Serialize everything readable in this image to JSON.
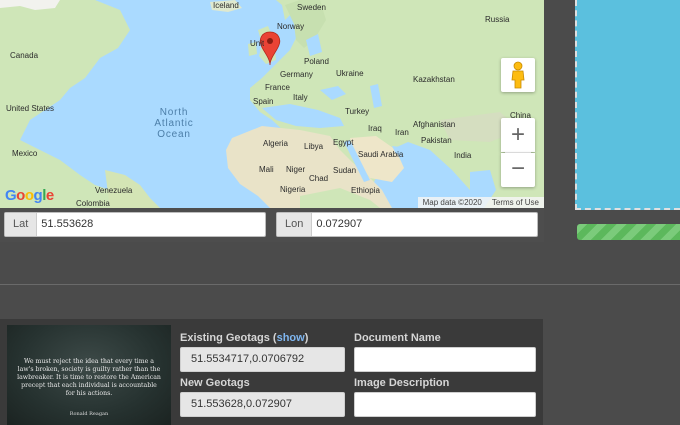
{
  "map": {
    "countries": [
      "Iceland",
      "Sweden",
      "Norway",
      "Russia",
      "Canada",
      "United Kingdom",
      "Poland",
      "Ukraine",
      "Kazakhstan",
      "Germany",
      "France",
      "Italy",
      "Spain",
      "Turkey",
      "United States",
      "China",
      "Iraq",
      "Iran",
      "Afghanistan",
      "Algeria",
      "Libya",
      "Egypt",
      "Saudi Arabia",
      "Pakistan",
      "India",
      "Mexico",
      "Mali",
      "Niger",
      "Chad",
      "Sudan",
      "Nigeria",
      "Ethiopia",
      "Venezuela",
      "Colombia"
    ],
    "ocean": "North Atlantic Ocean",
    "google_logo": "Google",
    "attribution": {
      "map_data": "Map data ©2020",
      "terms": "Terms of Use"
    },
    "zoom_in": "+",
    "zoom_out": "−",
    "marker_color": "#ea4335"
  },
  "coords": {
    "lat_label": "Lat",
    "lat_value": "51.553628",
    "lon_label": "Lon",
    "lon_value": "0.072907"
  },
  "preview": {
    "color": "#5bc0de"
  },
  "progress": {
    "fraction": 1.0,
    "color": "#5cb85c"
  },
  "card": {
    "thumbnail": {
      "quote": "We must reject the idea that every time a law's broken, society is guilty rather than the lawbreaker. It is time to restore the American precept that each individual is accountable for his actions.",
      "author": "Ronald Reagan"
    },
    "existing_geotags_label": "Existing Geotags (",
    "show_link": "show",
    "existing_geotags_close": ")",
    "existing_geotags_value": "51.5534717,0.0706792",
    "new_geotags_label": "New Geotags",
    "new_geotags_value": "51.553628,0.072907",
    "document_name_label": "Document Name",
    "document_name_value": "",
    "image_description_label": "Image Description",
    "image_description_value": ""
  }
}
